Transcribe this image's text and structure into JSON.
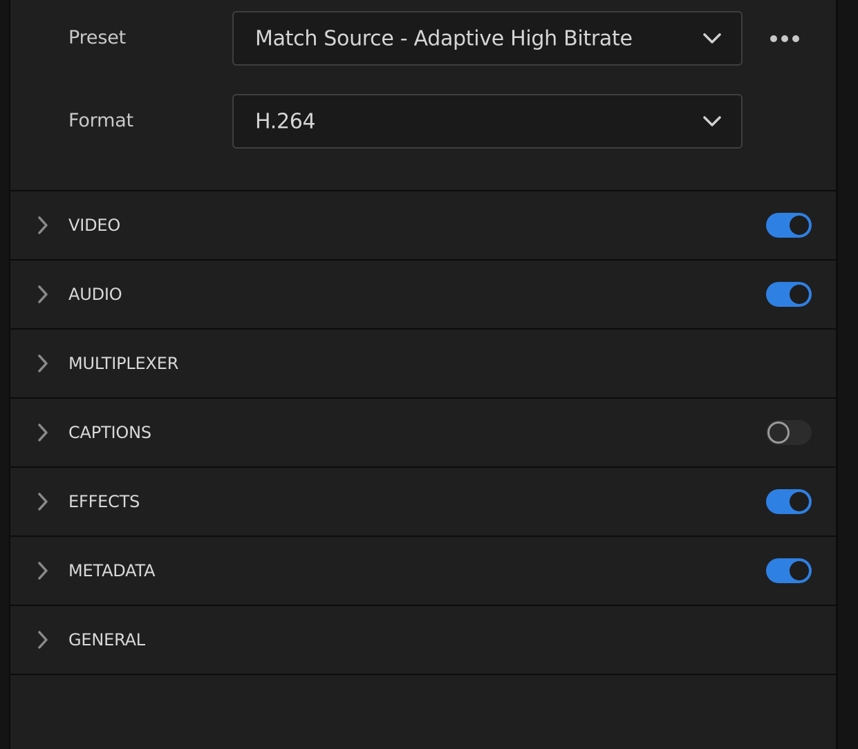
{
  "preset": {
    "label": "Preset",
    "value": "Match Source - Adaptive High Bitrate",
    "chevron_icon": "chevron-down-icon",
    "more_icon": "more-horizontal-icon"
  },
  "format": {
    "label": "Format",
    "value": "H.264",
    "chevron_icon": "chevron-down-icon"
  },
  "sections": [
    {
      "title": "VIDEO",
      "toggle": "on"
    },
    {
      "title": "AUDIO",
      "toggle": "on"
    },
    {
      "title": "MULTIPLEXER",
      "toggle": "none"
    },
    {
      "title": "CAPTIONS",
      "toggle": "off"
    },
    {
      "title": "EFFECTS",
      "toggle": "on"
    },
    {
      "title": "METADATA",
      "toggle": "on"
    },
    {
      "title": "GENERAL",
      "toggle": "none"
    }
  ],
  "colors": {
    "panel_background": "#1f1f20",
    "toggle_on": "#2f80e3",
    "toggle_off_ring": "#9a9a9a",
    "text": "#d9d9d9"
  }
}
